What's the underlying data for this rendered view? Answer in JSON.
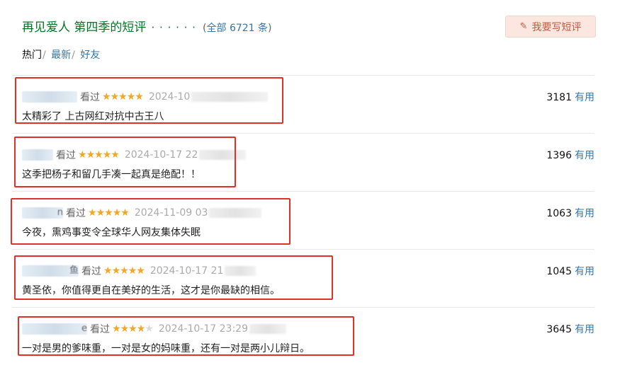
{
  "header": {
    "title": "再见爱人 第四季的短评",
    "dots": "· · · · · ·",
    "total_open": "(",
    "total_link": "全部 6721 条",
    "total_close": ")",
    "write_button": "我要写短评",
    "write_icon": "pencil-icon"
  },
  "tabs": {
    "hot": "热门",
    "latest": "最新",
    "friends": "好友",
    "sep": "/"
  },
  "comments": [
    {
      "user": "",
      "status": "看过",
      "rating": 5,
      "time": "2024-10",
      "votes": "3181",
      "useful": "有用",
      "text": "太精彩了 上古网红对抗中古王八"
    },
    {
      "user": "",
      "status": "看过",
      "rating": 5,
      "time": "2024-10-17 22",
      "votes": "1396",
      "useful": "有用",
      "text": "这季把杨子和留几手凑一起真是绝配！！"
    },
    {
      "user": "n",
      "status": "看过",
      "rating": 5,
      "time": "2024-11-09 03",
      "votes": "1063",
      "useful": "有用",
      "text": "今夜，熏鸡事变令全球华人网友集体失眠"
    },
    {
      "user": "鱼",
      "status": "看过",
      "rating": 5,
      "time": "2024-10-17 21",
      "votes": "1045",
      "useful": "有用",
      "text": "黄圣依，你值得更自在美好的生活，这才是你最缺的相信。"
    },
    {
      "user": "e",
      "status": "看过",
      "rating": 4,
      "time": "2024-10-17 23:29",
      "votes": "3645",
      "useful": "有用",
      "text": "一对是男的爹味重，一对是女的妈味重，还有一对是两小儿辩日。"
    }
  ],
  "colors": {
    "title_green": "#007722",
    "link_blue": "#3377aa",
    "star_gold": "#f5a623",
    "highlight_red": "#e0302a",
    "button_bg": "#fce7e0"
  }
}
